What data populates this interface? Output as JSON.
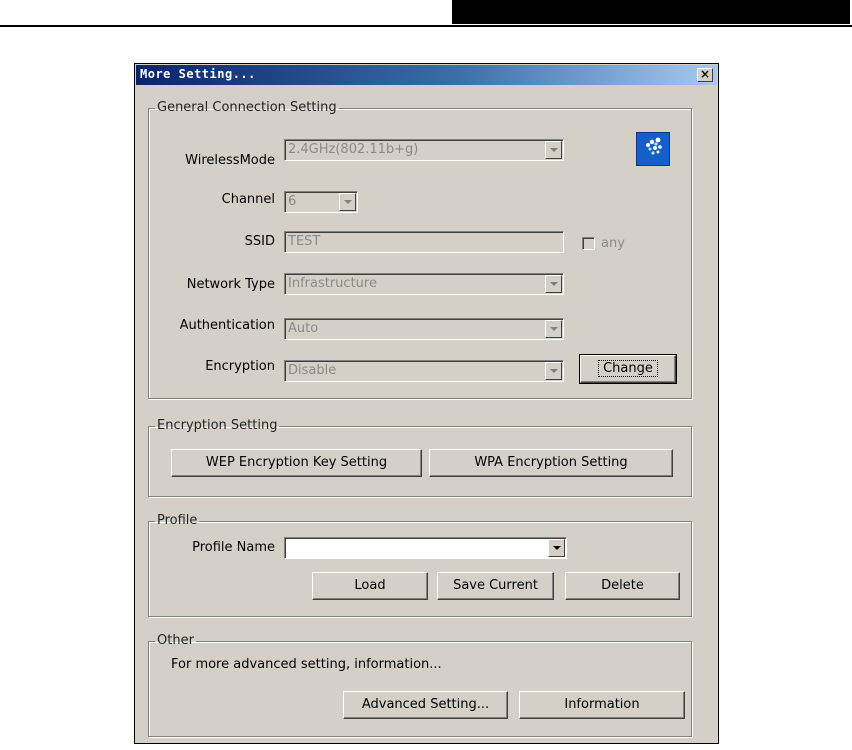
{
  "dialog": {
    "title": "More Setting...",
    "close_glyph": "×"
  },
  "general": {
    "legend": "General Connection Setting",
    "wireless_mode": {
      "label": "WirelessMode",
      "value": "2.4GHz(802.11b+g)"
    },
    "channel": {
      "label": "Channel",
      "value": "6"
    },
    "ssid": {
      "label": "SSID",
      "value": "TEST",
      "any_label": "any"
    },
    "network_type": {
      "label": "Network Type",
      "value": "Infrastructure"
    },
    "authentication": {
      "label": "Authentication",
      "value": "Auto"
    },
    "encryption": {
      "label": "Encryption",
      "value": "Disable"
    },
    "change_button": "Change",
    "icon": "wireless-network-icon"
  },
  "encryption_setting": {
    "legend": "Encryption Setting",
    "wep_button": "WEP Encryption Key Setting",
    "wpa_button": "WPA Encryption Setting"
  },
  "profile": {
    "legend": "Profile",
    "name_label": "Profile Name",
    "name_value": "",
    "load_button": "Load",
    "save_button": "Save Current",
    "delete_button": "Delete"
  },
  "other": {
    "legend": "Other",
    "text": "For more advanced setting, information...",
    "advanced_button": "Advanced Setting...",
    "information_button": "Information"
  },
  "colors": {
    "titlebar_start": "#0a246a",
    "titlebar_end": "#a6caf0",
    "dialog_bg": "#d4d0c8"
  }
}
